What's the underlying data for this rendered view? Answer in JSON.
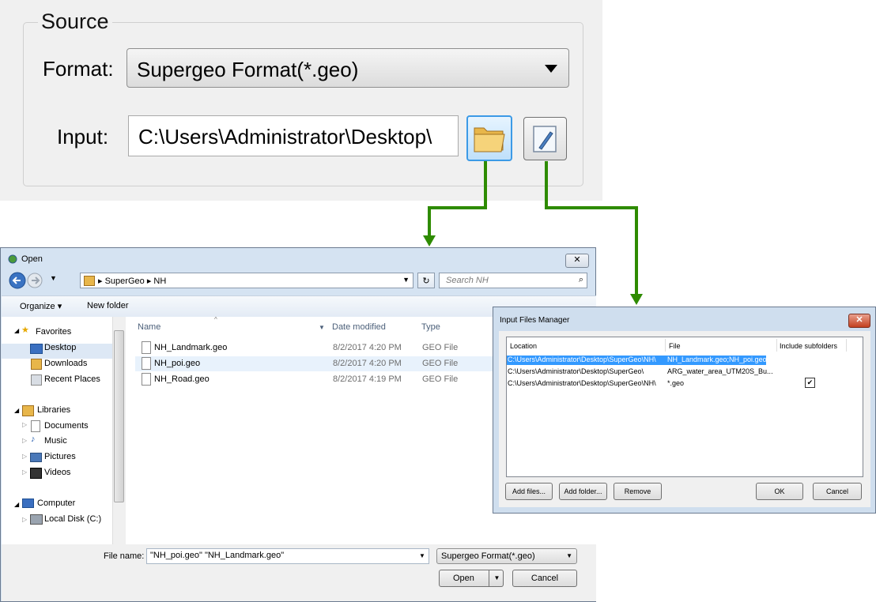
{
  "source": {
    "group_label": "Source",
    "format_label": "Format:",
    "format_value": "Supergeo Format(*.geo)",
    "input_label": "Input:",
    "input_value": "C:\\Users\\Administrator\\Desktop\\"
  },
  "open_dialog": {
    "title": "Open",
    "breadcrumb": [
      "SuperGeo",
      "NH"
    ],
    "search_placeholder": "Search NH",
    "toolbar": {
      "organize": "Organize ▾",
      "new_folder": "New folder"
    },
    "nav": {
      "favorites": "Favorites",
      "desktop": "Desktop",
      "downloads": "Downloads",
      "recent_places": "Recent Places",
      "libraries": "Libraries",
      "documents": "Documents",
      "music": "Music",
      "pictures": "Pictures",
      "videos": "Videos",
      "computer": "Computer",
      "local_disk": "Local Disk (C:)"
    },
    "columns": {
      "name": "Name",
      "date_modified": "Date modified",
      "type": "Type"
    },
    "files": [
      {
        "name": "NH_Landmark.geo",
        "date": "8/2/2017 4:20 PM",
        "type": "GEO File"
      },
      {
        "name": "NH_poi.geo",
        "date": "8/2/2017 4:20 PM",
        "type": "GEO File"
      },
      {
        "name": "NH_Road.geo",
        "date": "8/2/2017 4:19 PM",
        "type": "GEO File"
      }
    ],
    "file_name_label": "File name:",
    "file_name_value": "\"NH_poi.geo\" \"NH_Landmark.geo\"",
    "file_type_value": "Supergeo Format(*.geo)",
    "open_button": "Open",
    "cancel_button": "Cancel"
  },
  "files_manager": {
    "title": "Input Files Manager",
    "columns": {
      "location": "Location",
      "file": "File",
      "include_subfolders": "Include subfolders"
    },
    "rows": [
      {
        "location": "C:\\Users\\Administrator\\Desktop\\SuperGeo\\NH\\",
        "file": "NH_Landmark.geo;NH_poi.geo",
        "include_subfolders": ""
      },
      {
        "location": "C:\\Users\\Administrator\\Desktop\\SuperGeo\\",
        "file": "ARG_water_area_UTM20S_Bu...",
        "include_subfolders": ""
      },
      {
        "location": "C:\\Users\\Administrator\\Desktop\\SuperGeo\\NH\\",
        "file": "*.geo",
        "include_subfolders": "✔"
      }
    ],
    "buttons": {
      "add_files": "Add files...",
      "add_folder": "Add folder...",
      "remove": "Remove",
      "ok": "OK",
      "cancel": "Cancel"
    }
  },
  "colors": {
    "connector": "#2e8b00",
    "selection": "#3399ff",
    "title_close": "#c3401f"
  }
}
